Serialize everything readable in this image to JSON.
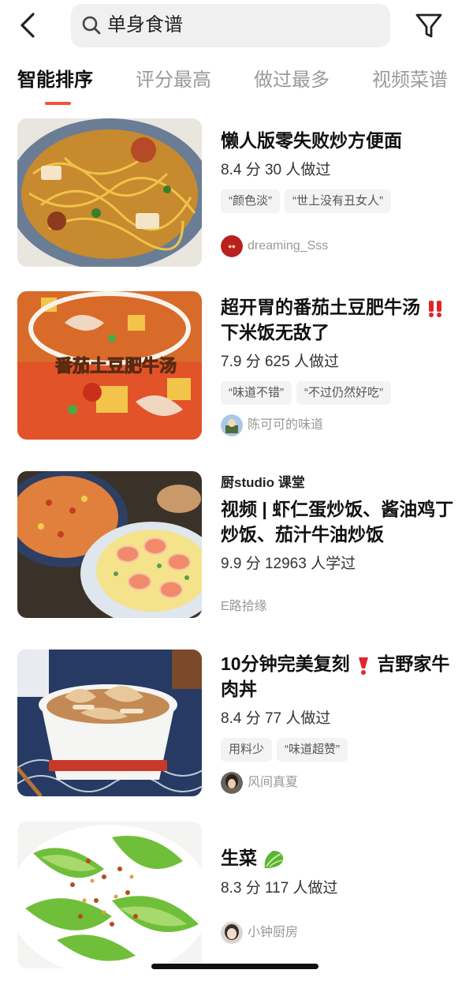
{
  "header": {
    "search_query": "单身食谱",
    "back_icon": "chevron-left-icon",
    "filter_icon": "funnel-icon"
  },
  "tabs": [
    {
      "label": "智能排序",
      "active": true
    },
    {
      "label": "评分最高",
      "active": false
    },
    {
      "label": "做过最多",
      "active": false
    },
    {
      "label": "视频菜谱",
      "active": false
    }
  ],
  "accent_color": "#f0553e",
  "recipes": [
    {
      "title": "懒人版零失败炒方便面",
      "meta": "8.4 分 30 人做过",
      "tags": [
        "“颜色淡”",
        "“世上没有丑女人”"
      ],
      "author": "dreaming_Sss"
    },
    {
      "title_part1": "超开胃的番茄土豆肥牛汤",
      "title_part2": "下米饭无敌了",
      "image_caption": "番茄土豆肥牛汤",
      "meta": "7.9 分 625 人做过",
      "tags": [
        "“味道不错”",
        "“不过仍然好吃”"
      ],
      "author": "陈可可的味道"
    },
    {
      "source": "厨studio 课堂",
      "title": "视频 | 虾仁蛋炒饭、酱油鸡丁炒饭、茄汁牛油炒饭",
      "meta": "9.9 分 12963 人学过",
      "author": "E路拾缘"
    },
    {
      "title_part1": "10分钟完美复刻",
      "title_part2": "吉野家牛肉丼",
      "meta": "8.4 分 77 人做过",
      "tags": [
        "用料少",
        "“味道超赞”"
      ],
      "author": "风间真夏"
    },
    {
      "title": "生菜",
      "meta": "8.3 分 117 人做过",
      "author": "小钟厨房"
    }
  ]
}
